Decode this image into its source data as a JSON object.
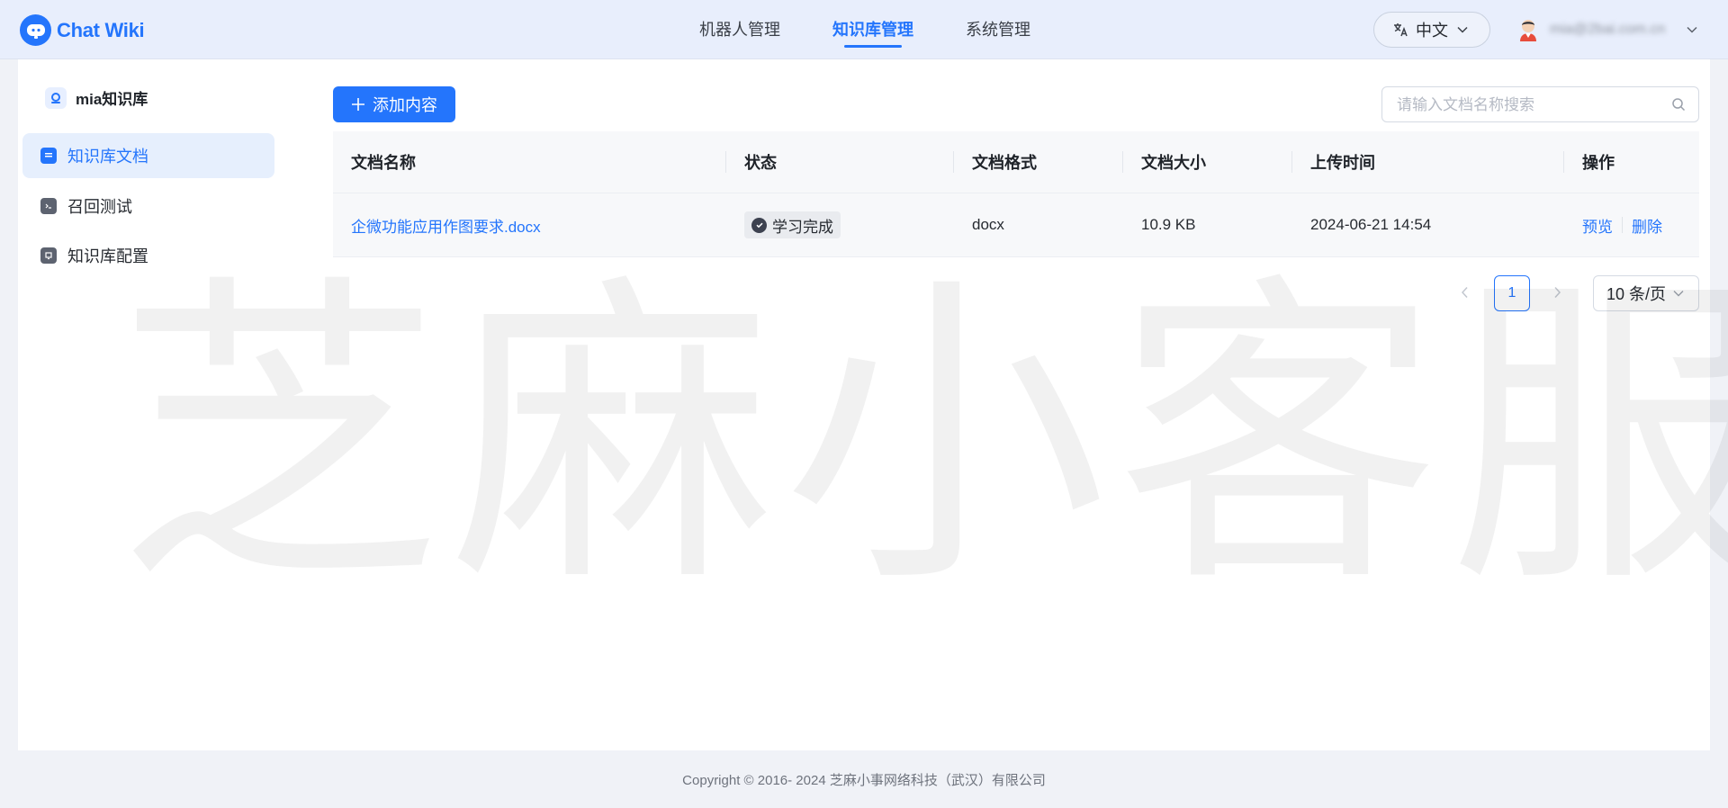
{
  "header": {
    "brand": "Chat Wiki",
    "nav": [
      {
        "label": "机器人管理",
        "active": false
      },
      {
        "label": "知识库管理",
        "active": true
      },
      {
        "label": "系统管理",
        "active": false
      }
    ],
    "language": "中文",
    "user_email": "mia@2bai.com.cn"
  },
  "sidebar": {
    "kb_name": "mia知识库",
    "items": [
      {
        "label": "知识库文档",
        "icon": "document-icon",
        "active": true
      },
      {
        "label": "召回测试",
        "icon": "terminal-icon",
        "active": false
      },
      {
        "label": "知识库配置",
        "icon": "config-icon",
        "active": false
      }
    ]
  },
  "toolbar": {
    "add_label": "添加内容",
    "search_placeholder": "请输入文档名称搜索"
  },
  "table": {
    "columns": [
      "文档名称",
      "状态",
      "文档格式",
      "文档大小",
      "上传时间",
      "操作"
    ],
    "rows": [
      {
        "name": "企微功能应用作图要求.docx",
        "status": "学习完成",
        "format": "docx",
        "size": "10.9 KB",
        "uploaded": "2024-06-21 14:54",
        "actions": [
          "预览",
          "删除"
        ]
      }
    ]
  },
  "pagination": {
    "current_page": "1",
    "page_size": "10 条/页"
  },
  "watermark": "芝麻小客服",
  "footer": "Copyright © 2016- 2024 芝麻小事网络科技（武汉）有限公司",
  "colors": {
    "accent": "#2475fc",
    "header_bg": "#e8eefc",
    "page_bg": "#f0f2f7"
  }
}
